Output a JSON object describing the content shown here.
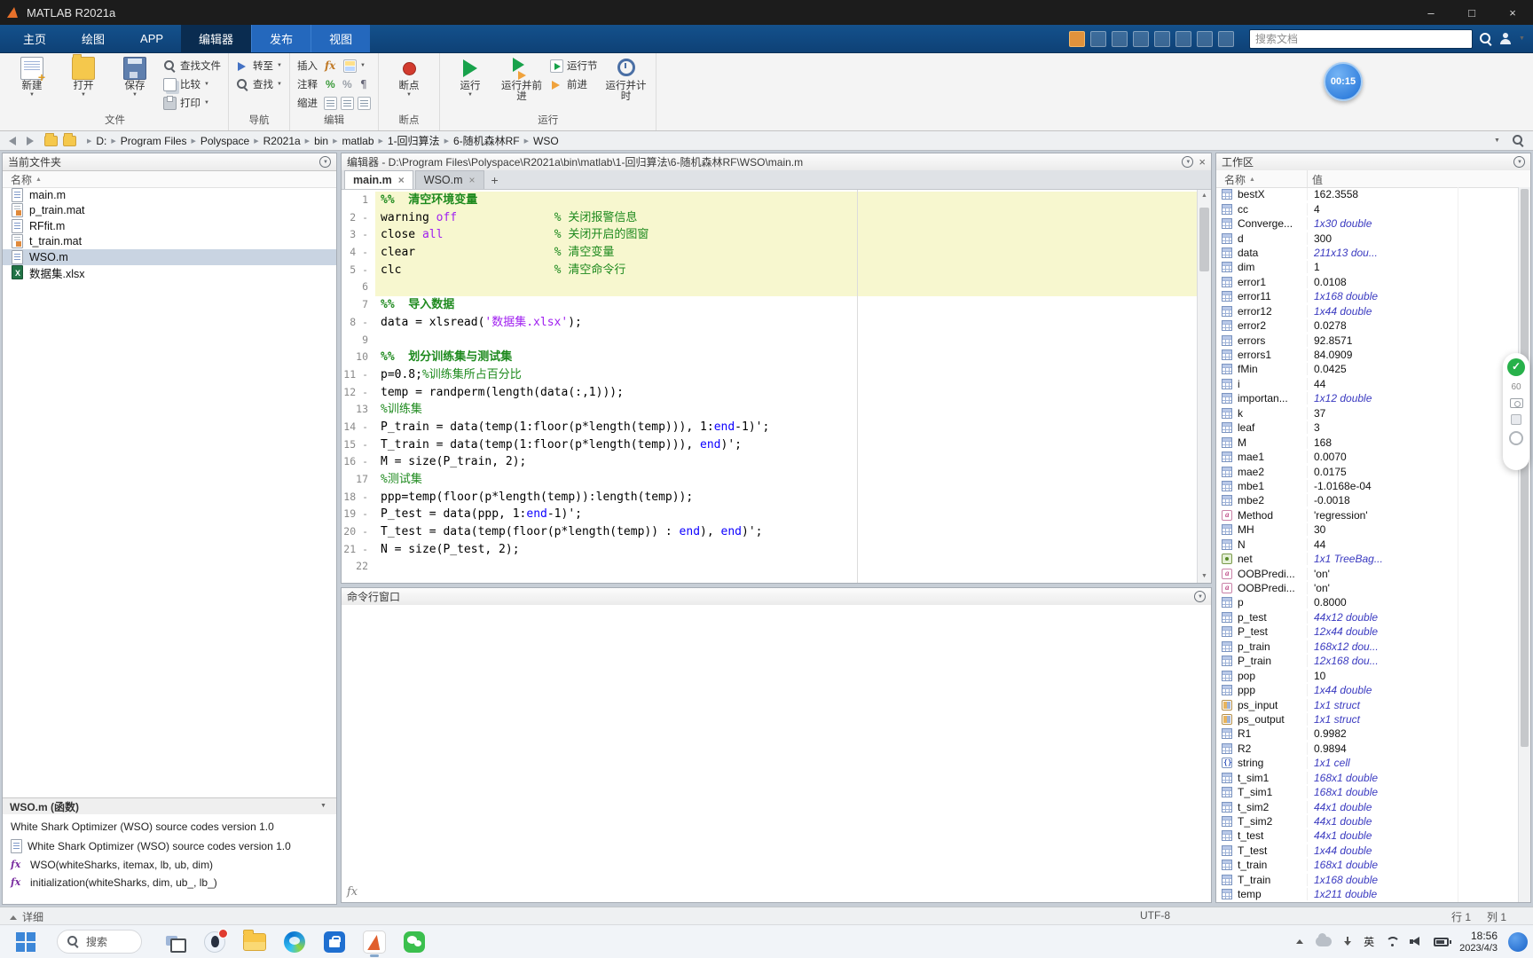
{
  "colors": {
    "ribbon_blue": "#0e4176",
    "active_tab": "#0a2c50",
    "contextual_tab": "#2468bd",
    "selection": "#c9d4e2",
    "comment_green": "#1e8a1e",
    "string_purple": "#a020f0",
    "keyword_blue": "#0d00ff",
    "section_highlight": "#f7f7cf",
    "run_green": "#18a24b",
    "matlab_orange": "#e05f2d"
  },
  "titlebar": {
    "title": "MATLAB R2021a",
    "minimize": "–",
    "maximize": "□",
    "close": "×"
  },
  "ribbon": {
    "tabs": [
      {
        "id": "home",
        "label": "主页",
        "kind": "normal"
      },
      {
        "id": "plots",
        "label": "绘图",
        "kind": "normal"
      },
      {
        "id": "apps",
        "label": "APP",
        "kind": "normal"
      },
      {
        "id": "editor",
        "label": "编辑器",
        "kind": "active"
      },
      {
        "id": "publish",
        "label": "发布",
        "kind": "contextual"
      },
      {
        "id": "view",
        "label": "视图",
        "kind": "contextual"
      }
    ],
    "quick_icons": [
      "open-recent-icon",
      "save-quick-icon",
      "cut-icon",
      "copy-icon",
      "paste-icon",
      "undo-icon",
      "redo-icon",
      "help-icon"
    ],
    "search_placeholder": "搜索文档",
    "groups": [
      {
        "id": "file",
        "label": "文件",
        "items": [
          {
            "kind": "big",
            "id": "new",
            "label": "新建",
            "icon": "new-script-icon",
            "caret": true
          },
          {
            "kind": "big",
            "id": "open",
            "label": "打开",
            "icon": "open-folder-icon",
            "caret": true
          },
          {
            "kind": "big",
            "id": "save",
            "label": "保存",
            "icon": "save-icon",
            "caret": true
          },
          {
            "kind": "small",
            "id": "find-files",
            "label": "查找文件",
            "icon": "find-files-icon"
          },
          {
            "kind": "small",
            "id": "compare",
            "label": "比较",
            "icon": "compare-icon",
            "caret": true
          },
          {
            "kind": "small",
            "id": "print",
            "label": "打印",
            "icon": "print-icon",
            "caret": true
          }
        ]
      },
      {
        "id": "navigate",
        "label": "导航",
        "items": [
          {
            "kind": "small",
            "id": "goto",
            "label": "转至",
            "icon": "goto-icon",
            "caret": true
          },
          {
            "kind": "small",
            "id": "find",
            "label": "查找",
            "icon": "find-icon",
            "caret": true
          }
        ]
      },
      {
        "id": "edit",
        "label": "编辑",
        "items": [
          {
            "kind": "row",
            "id": "insert",
            "label": "插入",
            "icons": [
              "fx-icon",
              "section-icon"
            ],
            "caret": true
          },
          {
            "kind": "row",
            "id": "comment",
            "label": "注释",
            "icons": [
              "comment-icon",
              "uncomment-icon",
              "wrap-comment-icon"
            ]
          },
          {
            "kind": "row",
            "id": "indent",
            "label": "缩进",
            "icons": [
              "indent-icon",
              "outdent-icon",
              "smart-indent-icon"
            ]
          }
        ]
      },
      {
        "id": "breakpoints",
        "label": "断点",
        "items": [
          {
            "kind": "big",
            "id": "breakpoints",
            "label": "断点",
            "icon": "breakpoints-icon",
            "caret": true
          }
        ]
      },
      {
        "id": "run",
        "label": "运行",
        "items": [
          {
            "kind": "big",
            "id": "run",
            "label": "运行",
            "icon": "run-icon",
            "caret": true
          },
          {
            "kind": "big",
            "id": "run-advance",
            "label": "运行并前进",
            "icon": "run-advance-icon"
          },
          {
            "kind": "small",
            "id": "run-section",
            "label": "运行节",
            "icon": "run-section-icon"
          },
          {
            "kind": "small",
            "id": "advance",
            "label": "前进",
            "icon": "advance-icon"
          },
          {
            "kind": "big",
            "id": "run-time",
            "label": "运行并计时",
            "icon": "run-time-icon"
          }
        ]
      }
    ]
  },
  "breadcrumb": {
    "segments": [
      "D:",
      "Program Files",
      "Polyspace",
      "R2021a",
      "bin",
      "matlab",
      "1-回归算法",
      "6-随机森林RF",
      "WSO"
    ]
  },
  "current_folder": {
    "title": "当前文件夹",
    "column_header": "名称",
    "files": [
      {
        "name": "main.m",
        "icon": "mfile-icon",
        "selected": false
      },
      {
        "name": "p_train.mat",
        "icon": "matfile-icon",
        "selected": false
      },
      {
        "name": "RFfit.m",
        "icon": "mfile-icon",
        "selected": false
      },
      {
        "name": "t_train.mat",
        "icon": "matfile-icon",
        "selected": false
      },
      {
        "name": "WSO.m",
        "icon": "mfile-icon",
        "selected": true
      },
      {
        "name": "数据集.xlsx",
        "icon": "xlsx-icon",
        "selected": false
      }
    ],
    "details": {
      "header": "WSO.m (函数)",
      "summary": "White Shark Optimizer (WSO) source codes version 1.0",
      "entries": [
        {
          "icon": "script-icon",
          "text": "White Shark Optimizer (WSO) source codes version 1.0"
        },
        {
          "icon": "function-icon",
          "text": "WSO(whiteSharks, itemax, lb, ub, dim)"
        },
        {
          "icon": "function-icon",
          "text": "initialization(whiteSharks, dim, ub_, lb_)"
        }
      ]
    }
  },
  "editor": {
    "title": "编辑器 - D:\\Program Files\\Polyspace\\R2021a\\bin\\matlab\\1-回归算法\\6-随机森林RF\\WSO\\main.m",
    "tabs": [
      {
        "label": "main.m",
        "active": true
      },
      {
        "label": "WSO.m",
        "active": false
      }
    ],
    "new_tab_label": "+",
    "code": [
      {
        "n": 1,
        "x": 0,
        "h": 1,
        "t": [
          [
            "%%  清空环境变量",
            "sec"
          ]
        ]
      },
      {
        "n": 2,
        "x": 1,
        "h": 1,
        "t": [
          [
            "warning ",
            "id"
          ],
          [
            "off",
            "str"
          ],
          [
            "              ",
            "id"
          ],
          [
            "% 关闭报警信息",
            "cm"
          ]
        ]
      },
      {
        "n": 3,
        "x": 1,
        "h": 1,
        "t": [
          [
            "close ",
            "id"
          ],
          [
            "all",
            "str"
          ],
          [
            "                ",
            "id"
          ],
          [
            "% 关闭开启的图窗",
            "cm"
          ]
        ]
      },
      {
        "n": 4,
        "x": 1,
        "h": 1,
        "t": [
          [
            "clear",
            "id"
          ],
          [
            "                    ",
            "id"
          ],
          [
            "% 清空变量",
            "cm"
          ]
        ]
      },
      {
        "n": 5,
        "x": 1,
        "h": 1,
        "t": [
          [
            "clc",
            "id"
          ],
          [
            "                      ",
            "id"
          ],
          [
            "% 清空命令行",
            "cm"
          ]
        ]
      },
      {
        "n": 6,
        "x": 0,
        "h": 1,
        "t": []
      },
      {
        "n": 7,
        "x": 0,
        "h": 0,
        "t": [
          [
            "%%  导入数据",
            "sec"
          ]
        ]
      },
      {
        "n": 8,
        "x": 1,
        "h": 0,
        "t": [
          [
            "data = xlsread(",
            "id"
          ],
          [
            "'数据集.xlsx'",
            "str"
          ],
          [
            ");",
            "id"
          ]
        ]
      },
      {
        "n": 9,
        "x": 0,
        "h": 0,
        "t": []
      },
      {
        "n": 10,
        "x": 0,
        "h": 0,
        "t": [
          [
            "%%  划分训练集与测试集",
            "sec"
          ]
        ]
      },
      {
        "n": 11,
        "x": 1,
        "h": 0,
        "t": [
          [
            "p=0.8;",
            "id"
          ],
          [
            "%训练集所占百分比",
            "cm"
          ]
        ]
      },
      {
        "n": 12,
        "x": 1,
        "h": 0,
        "t": [
          [
            "temp = randperm(length(data(:,1)));",
            "id"
          ]
        ]
      },
      {
        "n": 13,
        "x": 0,
        "h": 0,
        "t": [
          [
            "%训练集",
            "cm"
          ]
        ]
      },
      {
        "n": 14,
        "x": 1,
        "h": 0,
        "t": [
          [
            "P_train = data(temp(1:floor(p*length(temp))), 1:",
            "id"
          ],
          [
            "end",
            "kw"
          ],
          [
            "-1)';",
            "id"
          ]
        ]
      },
      {
        "n": 15,
        "x": 1,
        "h": 0,
        "t": [
          [
            "T_train = data(temp(1:floor(p*length(temp))), ",
            "id"
          ],
          [
            "end",
            "kw"
          ],
          [
            ")';",
            "id"
          ]
        ]
      },
      {
        "n": 16,
        "x": 1,
        "h": 0,
        "t": [
          [
            "M = size(P_train, 2);",
            "id"
          ]
        ]
      },
      {
        "n": 17,
        "x": 0,
        "h": 0,
        "t": [
          [
            "%测试集",
            "cm"
          ]
        ]
      },
      {
        "n": 18,
        "x": 1,
        "h": 0,
        "t": [
          [
            "ppp=temp(floor(p*length(temp)):length(temp));",
            "id"
          ]
        ]
      },
      {
        "n": 19,
        "x": 1,
        "h": 0,
        "t": [
          [
            "P_test = data(ppp, 1:",
            "id"
          ],
          [
            "end",
            "kw"
          ],
          [
            "-1)';",
            "id"
          ]
        ]
      },
      {
        "n": 20,
        "x": 1,
        "h": 0,
        "t": [
          [
            "T_test = data(temp(floor(p*length(temp)) : ",
            "id"
          ],
          [
            "end",
            "kw"
          ],
          [
            "), ",
            "id"
          ],
          [
            "end",
            "kw"
          ],
          [
            ")';",
            "id"
          ]
        ]
      },
      {
        "n": 21,
        "x": 1,
        "h": 0,
        "t": [
          [
            "N = size(P_test, 2);",
            "id"
          ]
        ]
      },
      {
        "n": 22,
        "x": 0,
        "h": 0,
        "t": []
      }
    ]
  },
  "command_window": {
    "title": "命令行窗口",
    "fx_label": "fx"
  },
  "workspace": {
    "title": "工作区",
    "col_name": "名称",
    "col_value": "值",
    "vars": [
      [
        "bestX",
        "162.3558",
        "numeric-icon",
        0
      ],
      [
        "cc",
        "4",
        "numeric-icon",
        0
      ],
      [
        "Converge...",
        "1x30 double",
        "numeric-icon",
        1
      ],
      [
        "d",
        "300",
        "numeric-icon",
        0
      ],
      [
        "data",
        "211x13 dou...",
        "numeric-icon",
        1
      ],
      [
        "dim",
        "1",
        "numeric-icon",
        0
      ],
      [
        "error1",
        "0.0108",
        "numeric-icon",
        0
      ],
      [
        "error11",
        "1x168 double",
        "numeric-icon",
        1
      ],
      [
        "error12",
        "1x44 double",
        "numeric-icon",
        1
      ],
      [
        "error2",
        "0.0278",
        "numeric-icon",
        0
      ],
      [
        "errors",
        "92.8571",
        "numeric-icon",
        0
      ],
      [
        "errors1",
        "84.0909",
        "numeric-icon",
        0
      ],
      [
        "fMin",
        "0.0425",
        "numeric-icon",
        0
      ],
      [
        "i",
        "44",
        "numeric-icon",
        0
      ],
      [
        "importan...",
        "1x12 double",
        "numeric-icon",
        1
      ],
      [
        "k",
        "37",
        "numeric-icon",
        0
      ],
      [
        "leaf",
        "3",
        "numeric-icon",
        0
      ],
      [
        "M",
        "168",
        "numeric-icon",
        0
      ],
      [
        "mae1",
        "0.0070",
        "numeric-icon",
        0
      ],
      [
        "mae2",
        "0.0175",
        "numeric-icon",
        0
      ],
      [
        "mbe1",
        "-1.0168e-04",
        "numeric-icon",
        0
      ],
      [
        "mbe2",
        "-0.0018",
        "numeric-icon",
        0
      ],
      [
        "Method",
        "'regression'",
        "char-icon",
        0
      ],
      [
        "MH",
        "30",
        "numeric-icon",
        0
      ],
      [
        "N",
        "44",
        "numeric-icon",
        0
      ],
      [
        "net",
        "1x1 TreeBag...",
        "obj-icon",
        1
      ],
      [
        "OOBPredi...",
        "'on'",
        "char-icon",
        0
      ],
      [
        "OOBPredi...",
        "'on'",
        "char-icon",
        0
      ],
      [
        "p",
        "0.8000",
        "numeric-icon",
        0
      ],
      [
        "p_test",
        "44x12 double",
        "numeric-icon",
        1
      ],
      [
        "P_test",
        "12x44 double",
        "numeric-icon",
        1
      ],
      [
        "p_train",
        "168x12 dou...",
        "numeric-icon",
        1
      ],
      [
        "P_train",
        "12x168 dou...",
        "numeric-icon",
        1
      ],
      [
        "pop",
        "10",
        "numeric-icon",
        0
      ],
      [
        "ppp",
        "1x44 double",
        "numeric-icon",
        1
      ],
      [
        "ps_input",
        "1x1 struct",
        "struct-icon",
        1
      ],
      [
        "ps_output",
        "1x1 struct",
        "struct-icon",
        1
      ],
      [
        "R1",
        "0.9982",
        "numeric-icon",
        0
      ],
      [
        "R2",
        "0.9894",
        "numeric-icon",
        0
      ],
      [
        "string",
        "1x1 cell",
        "cell-icon",
        1
      ],
      [
        "t_sim1",
        "168x1 double",
        "numeric-icon",
        1
      ],
      [
        "T_sim1",
        "168x1 double",
        "numeric-icon",
        1
      ],
      [
        "t_sim2",
        "44x1 double",
        "numeric-icon",
        1
      ],
      [
        "T_sim2",
        "44x1 double",
        "numeric-icon",
        1
      ],
      [
        "t_test",
        "44x1 double",
        "numeric-icon",
        1
      ],
      [
        "T_test",
        "1x44 double",
        "numeric-icon",
        1
      ],
      [
        "t_train",
        "168x1 double",
        "numeric-icon",
        1
      ],
      [
        "T_train",
        "1x168 double",
        "numeric-icon",
        1
      ],
      [
        "temp",
        "1x211 double",
        "numeric-icon",
        1
      ]
    ]
  },
  "statusbar": {
    "left_label": "详细",
    "encoding": "UTF-8",
    "line": "行 1",
    "column": "列 1"
  },
  "taskbar": {
    "search_label": "搜索",
    "apps": [
      {
        "name": "task-view-icon",
        "badge": false,
        "active": false
      },
      {
        "name": "qq-icon",
        "badge": true,
        "active": false
      },
      {
        "name": "file-explorer-icon",
        "badge": false,
        "active": false
      },
      {
        "name": "edge-icon",
        "badge": false,
        "active": false
      },
      {
        "name": "store-icon",
        "badge": false,
        "active": false
      },
      {
        "name": "matlab-icon",
        "badge": false,
        "active": true
      },
      {
        "name": "wechat-icon",
        "badge": false,
        "active": false
      }
    ],
    "tray": {
      "lang": "英",
      "time": "18:56",
      "date": "2023/4/3"
    }
  },
  "overlays": {
    "recording_timer": "00:15",
    "widget_counter": "60"
  }
}
